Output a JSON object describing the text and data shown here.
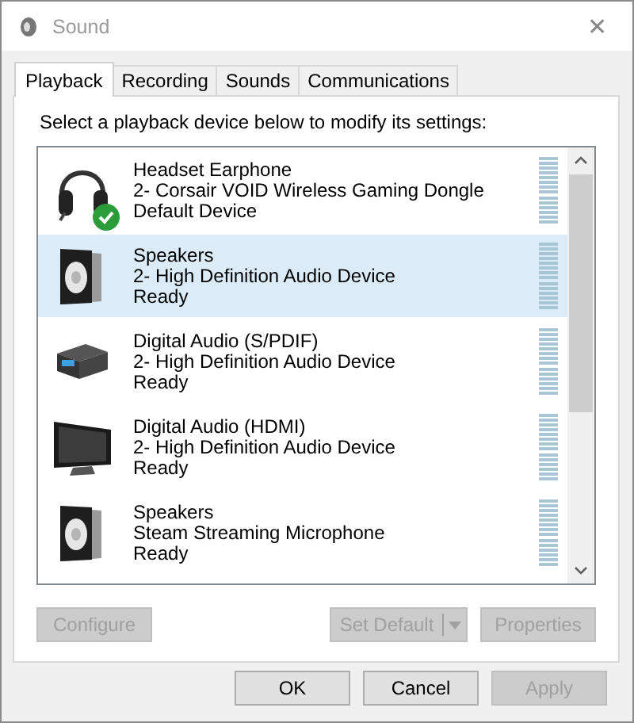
{
  "window": {
    "title": "Sound",
    "close": "✕"
  },
  "tabs": [
    {
      "label": "Playback",
      "selected": true
    },
    {
      "label": "Recording",
      "selected": false
    },
    {
      "label": "Sounds",
      "selected": false
    },
    {
      "label": "Communications",
      "selected": false
    }
  ],
  "instruction": "Select a playback device below to modify its settings:",
  "devices": [
    {
      "kind": "headset",
      "name": "Headset Earphone",
      "description": "2- Corsair VOID Wireless Gaming Dongle",
      "status": "Default Device",
      "default": true,
      "selected": false
    },
    {
      "kind": "speaker",
      "name": "Speakers",
      "description": "2- High Definition Audio Device",
      "status": "Ready",
      "default": false,
      "selected": true
    },
    {
      "kind": "spdif",
      "name": "Digital Audio (S/PDIF)",
      "description": "2- High Definition Audio Device",
      "status": "Ready",
      "default": false,
      "selected": false
    },
    {
      "kind": "monitor",
      "name": "Digital Audio (HDMI)",
      "description": "2- High Definition Audio Device",
      "status": "Ready",
      "default": false,
      "selected": false
    },
    {
      "kind": "speaker",
      "name": "Speakers",
      "description": "Steam Streaming Microphone",
      "status": "Ready",
      "default": false,
      "selected": false
    }
  ],
  "panel_buttons": [
    {
      "kind": "plain",
      "label": "Configure",
      "disabled": true
    },
    {
      "kind": "split",
      "label": "Set Default",
      "disabled": true
    },
    {
      "kind": "plain",
      "label": "Properties",
      "disabled": true
    }
  ],
  "dialog_buttons": [
    {
      "label": "OK",
      "disabled": false
    },
    {
      "label": "Cancel",
      "disabled": false
    },
    {
      "label": "Apply",
      "disabled": true
    }
  ]
}
